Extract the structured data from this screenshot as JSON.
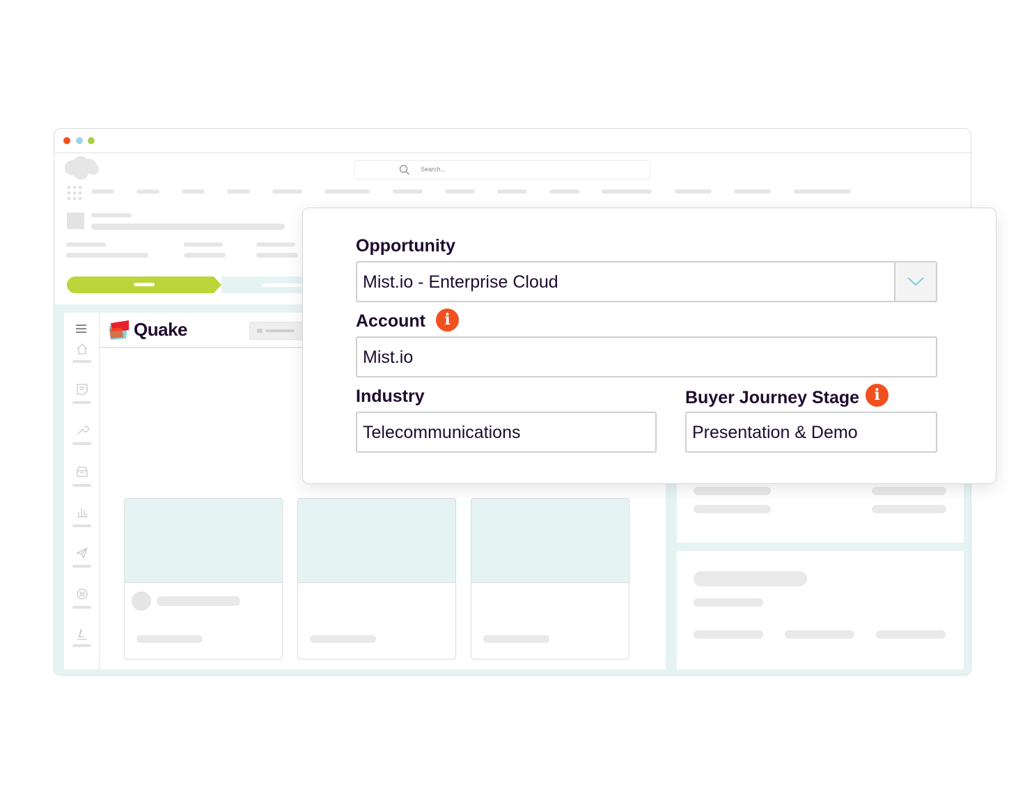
{
  "window": {
    "traffic_lights": [
      "#f0501e",
      "#9ed3e6",
      "#a8cf45"
    ],
    "search_placeholder": "Search..."
  },
  "app": {
    "brand_name": "Quake",
    "brand_colors": [
      "#e8202a",
      "#f0501e",
      "#7fd0d8"
    ]
  },
  "form": {
    "opportunity": {
      "label": "Opportunity",
      "value": "Mist.io - Enterprise Cloud"
    },
    "account": {
      "label": "Account",
      "value": "Mist.io",
      "info_icon": "i"
    },
    "industry": {
      "label": "Industry",
      "value": "Telecommunications"
    },
    "buyer_stage": {
      "label": "Buyer Journey Stage",
      "value": "Presentation & Demo",
      "info_icon": "i"
    }
  },
  "colors": {
    "accent": "#f0501e",
    "progress": "#bcd53a",
    "teal_bg": "#e6f3f3",
    "text": "#1e0b2e"
  },
  "icons": [
    "search-icon",
    "cloud-logo-icon",
    "app-launcher-icon",
    "hamburger-icon",
    "home-icon",
    "notes-icon",
    "wrench-icon",
    "inbox-icon",
    "chart-icon",
    "send-icon",
    "hashtag-icon",
    "signature-icon",
    "info-icon",
    "chevron-down-icon"
  ]
}
